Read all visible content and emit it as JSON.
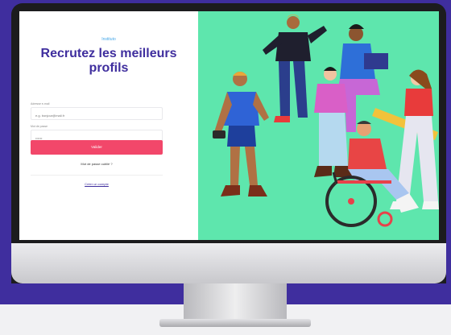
{
  "login": {
    "brand": "Instituto",
    "headline": "Recrutez les meilleurs profils",
    "email_label": "Adresse e-mail",
    "email_placeholder": "e.g. bonjour@mail.fr",
    "password_label": "Mot de passe",
    "password_placeholder": "••••••",
    "submit_label": "Valider",
    "forgot_link": "Mot de passe oublié ?",
    "create_link": "Créer un compte"
  },
  "colors": {
    "brand_purple": "#3f2e9e",
    "accent_pink": "#f2476a",
    "illustration_bg": "#5ee6ad",
    "brand_blue": "#45a7e8"
  }
}
